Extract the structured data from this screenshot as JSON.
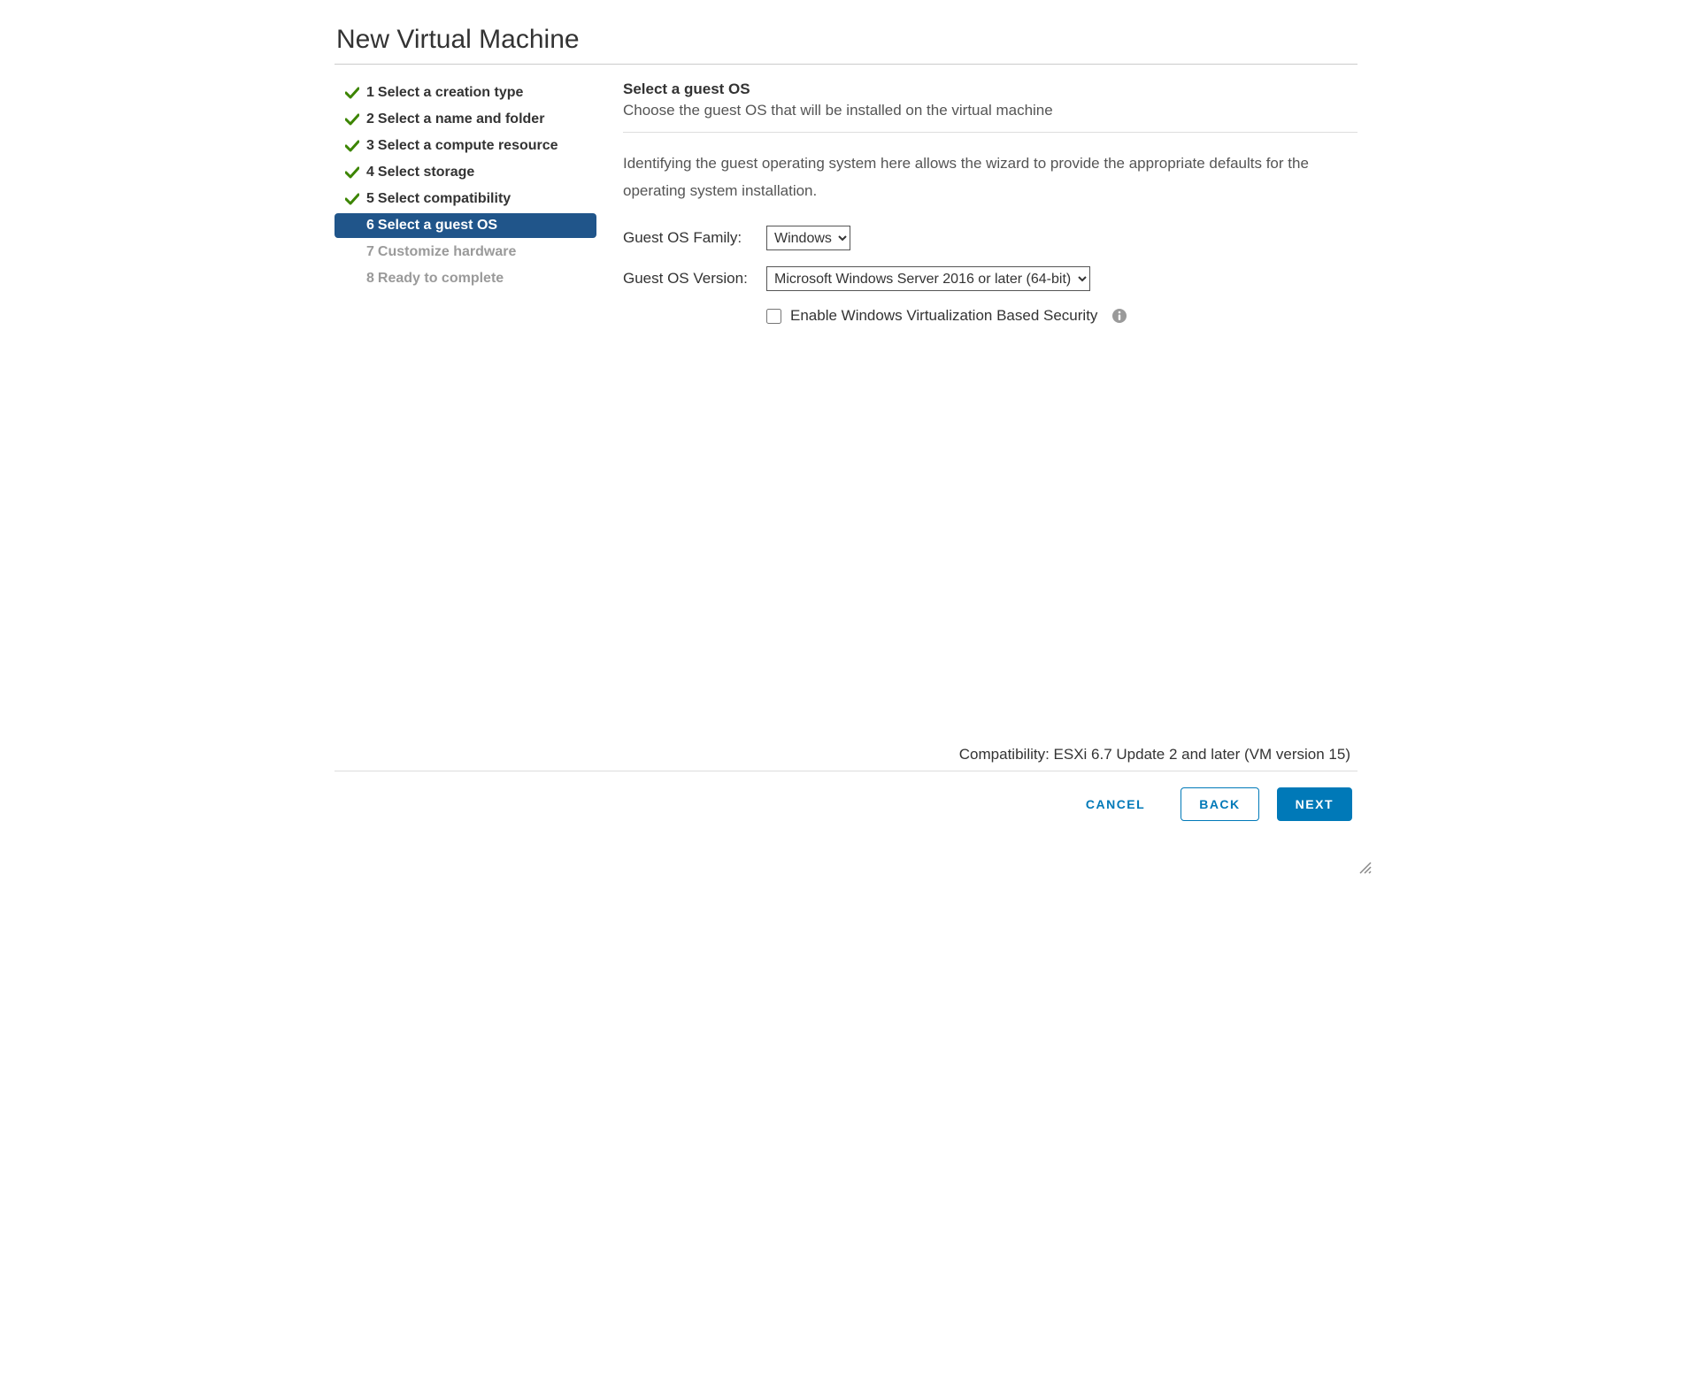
{
  "dialog": {
    "title": "New Virtual Machine"
  },
  "steps": [
    {
      "num": "1",
      "label": "Select a creation type",
      "state": "completed"
    },
    {
      "num": "2",
      "label": "Select a name and folder",
      "state": "completed"
    },
    {
      "num": "3",
      "label": "Select a compute resource",
      "state": "completed"
    },
    {
      "num": "4",
      "label": "Select storage",
      "state": "completed"
    },
    {
      "num": "5",
      "label": "Select compatibility",
      "state": "completed"
    },
    {
      "num": "6",
      "label": "Select a guest OS",
      "state": "active"
    },
    {
      "num": "7",
      "label": "Customize hardware",
      "state": "pending"
    },
    {
      "num": "8",
      "label": "Ready to complete",
      "state": "pending"
    }
  ],
  "main": {
    "title": "Select a guest OS",
    "subtitle": "Choose the guest OS that will be installed on the virtual machine",
    "description": "Identifying the guest operating system here allows the wizard to provide the appropriate defaults for the operating system installation.",
    "family_label": "Guest OS Family:",
    "family_value": "Windows",
    "version_label": "Guest OS Version:",
    "version_value": "Microsoft Windows Server 2016 or later (64-bit)",
    "vbs_label": "Enable Windows Virtualization Based Security",
    "vbs_checked": false,
    "compatibility": "Compatibility: ESXi 6.7 Update 2 and later (VM version 15)"
  },
  "footer": {
    "cancel": "CANCEL",
    "back": "BACK",
    "next": "NEXT"
  }
}
